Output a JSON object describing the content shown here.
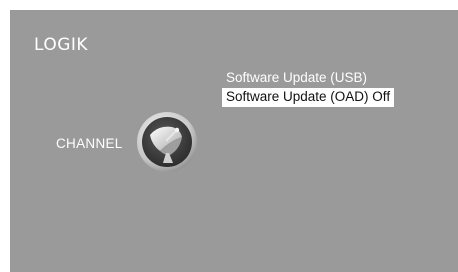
{
  "brand": {
    "name": "LOGIK"
  },
  "category": {
    "label": "CHANNEL",
    "icon": "satellite-dish-icon"
  },
  "menu": {
    "items": [
      {
        "label": "Software Update (USB)",
        "selected": false
      },
      {
        "label": "Software Update (OAD) Off",
        "selected": true
      }
    ]
  },
  "colors": {
    "background": "#9a9a9a",
    "text": "#ffffff",
    "selection_background": "#ffffff",
    "selection_text": "#111111"
  }
}
